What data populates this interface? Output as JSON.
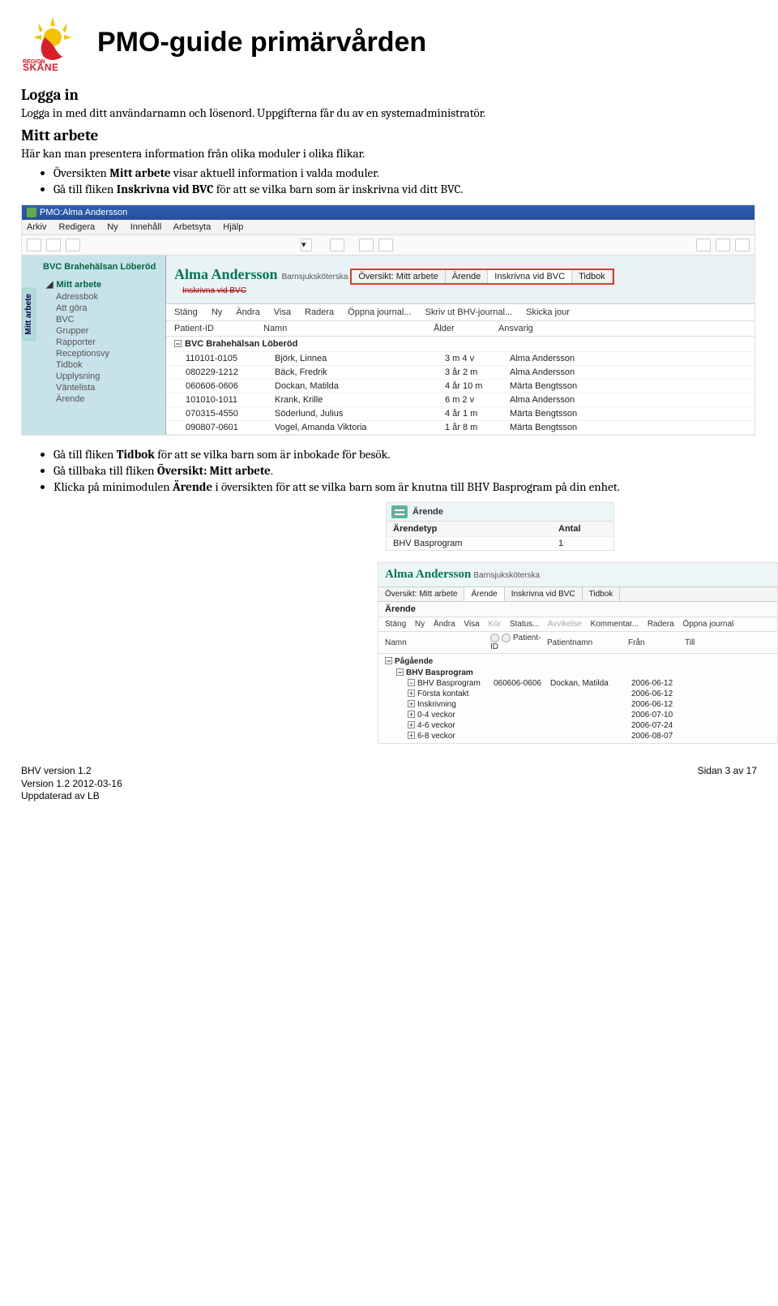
{
  "doc": {
    "title": "PMO-guide primärvården",
    "section1": {
      "heading": "Logga in",
      "body": "Logga in med ditt användarnamn och lösenord. Uppgifterna får du av en systemadministratör."
    },
    "section2": {
      "heading": "Mitt arbete",
      "body": "Här kan man presentera information från olika moduler i olika flikar."
    },
    "bullets1": [
      {
        "pre": "Översikten ",
        "b": "Mitt arbete",
        "post": " visar aktuell information i valda moduler."
      },
      {
        "pre": "Gå till fliken ",
        "b": "Inskrivna vid BVC",
        "post": " för att se vilka barn som är inskrivna vid ditt BVC."
      }
    ],
    "bullets2": [
      {
        "pre": "Gå till fliken ",
        "b": "Tidbok",
        "post": " för att se vilka barn som är inbokade för besök."
      },
      {
        "pre": "Gå tillbaka till fliken ",
        "b": "Översikt: Mitt arbete",
        "post": "."
      },
      {
        "pre": "Klicka på minimodulen ",
        "b": "Ärende",
        "post": " i översikten för att se vilka barn som är knutna till BHV Basprogram på din enhet."
      }
    ],
    "footer": {
      "l1": "BHV version 1.2",
      "l2": "Version 1.2 2012-03-16",
      "l3": "Uppdaterad av LB",
      "r": "Sidan 3 av 17"
    }
  },
  "shot1": {
    "titlebar": "PMO:Alma Andersson",
    "menu": [
      "Arkiv",
      "Redigera",
      "Ny",
      "Innehåll",
      "Arbetsyta",
      "Hjälp"
    ],
    "sidetab": "Mitt arbete",
    "unit": "BVC Brahehälsan Löberöd",
    "treeRoot": "Mitt arbete",
    "tree": [
      "Adressbok",
      "Att göra",
      "BVC",
      "Grupper",
      "Rapporter",
      "Receptionsvy",
      "Tidbok",
      "Upplysning",
      "Väntelista",
      "Ärende"
    ],
    "name": "Alma Andersson",
    "role": "Barnsjuksköterska",
    "tabs": [
      "Översikt: Mitt arbete",
      "Ärende",
      "Inskrivna vid BVC",
      "Tidbok"
    ],
    "subline": "Inskrivna vid BVC",
    "actions": [
      "Stäng",
      "Ny",
      "Ändra",
      "Visa",
      "Radera",
      "Öppna journal...",
      "Skriv ut BHV-journal...",
      "Skicka jour"
    ],
    "cols": [
      "Patient-ID",
      "Namn",
      "Ålder",
      "Ansvarig"
    ],
    "group": "BVC Brahehälsan Löberöd",
    "rows": [
      {
        "id": "110101-0105",
        "n": "Björk, Linnea",
        "a": "3 m 4 v",
        "r": "Alma Andersson"
      },
      {
        "id": "080229-1212",
        "n": "Bäck, Fredrik",
        "a": "3 år 2 m",
        "r": "Alma Andersson"
      },
      {
        "id": "060606-0606",
        "n": "Dockan, Matilda",
        "a": "4 år 10 m",
        "r": "Märta Bengtsson"
      },
      {
        "id": "101010-1011",
        "n": "Krank, Krille",
        "a": "6 m 2 v",
        "r": "Alma Andersson"
      },
      {
        "id": "070315-4550",
        "n": "Söderlund, Julius",
        "a": "4 år 1 m",
        "r": "Märta Bengtsson"
      },
      {
        "id": "090807-0601",
        "n": "Vogel, Amanda Viktoria",
        "a": "1 år 8 m",
        "r": "Märta Bengtsson"
      }
    ]
  },
  "shot2": {
    "title": "Ärende",
    "cols": [
      "Ärendetyp",
      "Antal"
    ],
    "row": [
      "BHV Basprogram",
      "1"
    ]
  },
  "shot3": {
    "name": "Alma Andersson",
    "role": "Barnsjuksköterska",
    "tabs": [
      "Översikt: Mitt arbete",
      "Ärende",
      "Inskrivna vid BVC",
      "Tidbok"
    ],
    "section": "Ärende",
    "actions": [
      "Stäng",
      "Ny",
      "Ändra",
      "Visa",
      "Kör",
      "Status...",
      "Avvikelse",
      "Kommentar...",
      "Radera",
      "Öppna journal"
    ],
    "cols": [
      "Namn",
      "Patient-ID",
      "Patientnamn",
      "Från",
      "Till"
    ],
    "lvl0": "Pågående",
    "lvl1": "BHV Basprogram",
    "rows": [
      {
        "n": "BHV Basprogram",
        "id": "060606-0606",
        "p": "Dockan, Matilda",
        "f": "2006-06-12",
        "t": ""
      },
      {
        "n": "Första kontakt",
        "id": "",
        "p": "",
        "f": "2006-06-12",
        "t": ""
      },
      {
        "n": "Inskrivning",
        "id": "",
        "p": "",
        "f": "2006-06-12",
        "t": ""
      },
      {
        "n": "0-4 veckor",
        "id": "",
        "p": "",
        "f": "2006-07-10",
        "t": ""
      },
      {
        "n": "4-6 veckor",
        "id": "",
        "p": "",
        "f": "2006-07-24",
        "t": ""
      },
      {
        "n": "6-8 veckor",
        "id": "",
        "p": "",
        "f": "2006-08-07",
        "t": ""
      }
    ]
  }
}
